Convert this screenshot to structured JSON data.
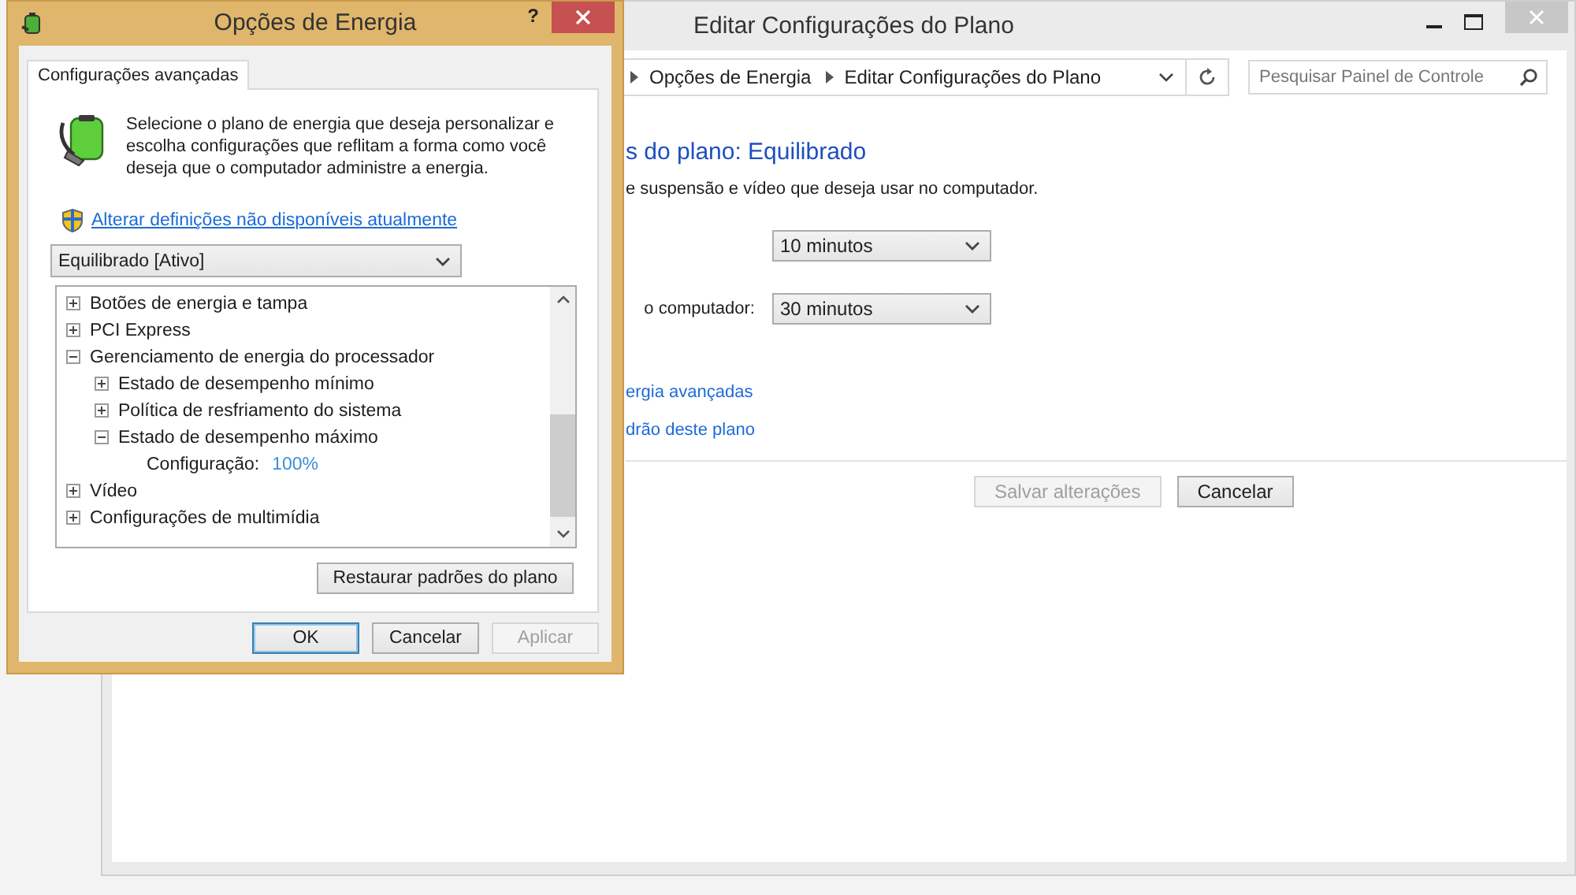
{
  "window": {
    "title": "Editar Configurações do Plano",
    "breadcrumb": [
      "Opções de Energia",
      "Editar Configurações do Plano"
    ],
    "search": {
      "placeholder": "Pesquisar Painel de Controle"
    },
    "heading": "s do plano: Equilibrado",
    "subtitle": "e suspensão e vídeo que deseja usar no computador.",
    "settings": [
      {
        "value": "10 minutos"
      },
      {
        "label": "o computador:",
        "value": "30 minutos"
      }
    ],
    "links": [
      "ergia avançadas",
      "drão deste plano"
    ],
    "buttons": [
      {
        "label": "Salvar alterações",
        "disabled": true
      },
      {
        "label": "Cancelar",
        "disabled": false
      }
    ]
  },
  "dialog": {
    "title": "Opções de Energia",
    "help_button": "?",
    "tabs": [
      {
        "label": "Configurações avançadas",
        "selected": true
      }
    ],
    "description": "Selecione o plano de energia que deseja personalizar e escolha configurações que reflitam a forma como você deseja que o computador administre a energia.",
    "admin_link": "Alterar definições não disponíveis atualmente",
    "plan_select": {
      "value": "Equilibrado [Ativo]"
    },
    "settings_tree": [
      {
        "label": "Botões de energia e tampa",
        "expanded": false
      },
      {
        "label": "PCI Express",
        "expanded": false
      },
      {
        "label": "Gerenciamento de energia do processador",
        "expanded": true,
        "children": [
          {
            "label": "Estado de desempenho mínimo",
            "expanded": false
          },
          {
            "label": "Política de resfriamento do sistema",
            "expanded": false
          },
          {
            "label": "Estado de desempenho máximo",
            "expanded": true,
            "children": [
              {
                "kind": "setting",
                "label": "Configuração:",
                "value": "100%"
              }
            ]
          }
        ]
      },
      {
        "label": "Vídeo",
        "expanded": false
      },
      {
        "label": "Configurações de multimídia",
        "expanded": false
      }
    ],
    "restore_button": "Restaurar padrões do plano",
    "buttons": [
      {
        "label": "OK",
        "focused": true,
        "disabled": false
      },
      {
        "label": "Cancelar",
        "focused": false,
        "disabled": false
      },
      {
        "label": "Aplicar",
        "focused": false,
        "disabled": true
      }
    ]
  }
}
